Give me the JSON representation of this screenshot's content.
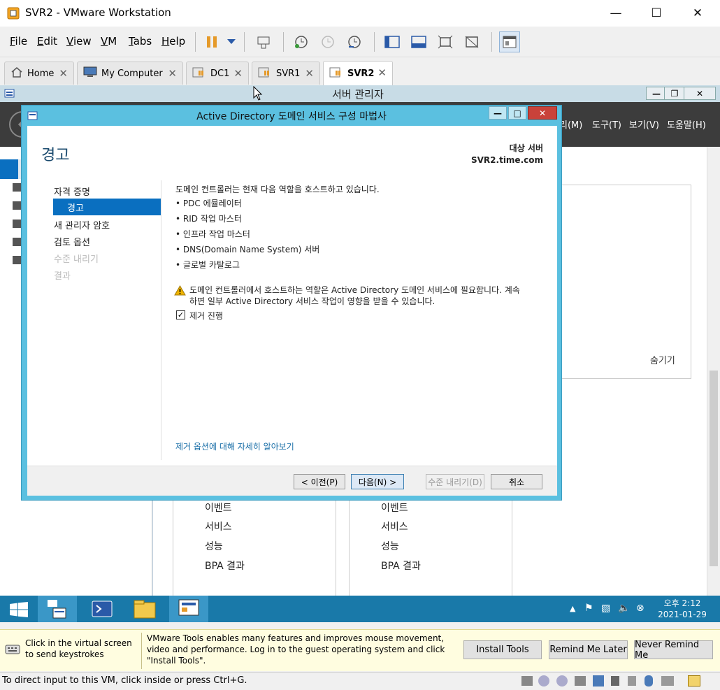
{
  "window": {
    "title": "SVR2 - VMware Workstation"
  },
  "menu": {
    "items": [
      {
        "label": "File",
        "key": "F",
        "rest": "ile"
      },
      {
        "label": "Edit",
        "key": "E",
        "rest": "dit"
      },
      {
        "label": "View",
        "key": "V",
        "rest": "iew"
      },
      {
        "label": "VM",
        "key": "V",
        "rest": "M"
      },
      {
        "label": "Tabs",
        "key": "T",
        "rest": "abs"
      },
      {
        "label": "Help",
        "key": "H",
        "rest": "elp"
      }
    ]
  },
  "tabs": [
    {
      "label": "Home",
      "icon": "home-icon"
    },
    {
      "label": "My Computer",
      "icon": "computer-icon"
    },
    {
      "label": "DC1",
      "icon": "vm-icon"
    },
    {
      "label": "SVR1",
      "icon": "vm-icon"
    },
    {
      "label": "SVR2",
      "icon": "vm-icon",
      "active": true
    }
  ],
  "server_manager": {
    "title": "서버 관리자",
    "menus": [
      "리(M)",
      "도구(T)",
      "보기(V)",
      "도움말(H)"
    ],
    "hide_label": "숨기기",
    "tiles": [
      {
        "items": [
          "이벤트",
          "서비스",
          "성능",
          "BPA 결과"
        ]
      },
      {
        "items": [
          "이벤트",
          "서비스",
          "성능",
          "BPA 결과"
        ]
      }
    ]
  },
  "wizard": {
    "title": "Active Directory 도메인 서비스 구성 마법사",
    "heading": "경고",
    "target_label": "대상 서버",
    "target_value": "SVR2.time.com",
    "nav": [
      {
        "label": "자격 증명",
        "state": "normal"
      },
      {
        "label": "경고",
        "state": "selected"
      },
      {
        "label": "새 관리자 암호",
        "state": "normal"
      },
      {
        "label": "검토 옵션",
        "state": "normal"
      },
      {
        "label": "수준 내리기",
        "state": "disabled"
      },
      {
        "label": "결과",
        "state": "disabled"
      }
    ],
    "intro": "도메인 컨트롤러는 현재 다음 역할을 호스트하고 있습니다.",
    "roles": [
      "PDC 에뮬레이터",
      "RID 작업 마스터",
      "인프라 작업 마스터",
      "DNS(Domain Name System) 서버",
      "글로벌 카탈로그"
    ],
    "warning_line1": "도메인 컨트롤러에서 호스트하는 역할은 Active Directory 도메인 서비스에 필요합니다. 계속",
    "warning_line2": "하면 일부 Active Directory 서비스 작업이 영향을 받을 수 있습니다.",
    "checkbox_label": "제거 진행",
    "checkbox_checked": true,
    "link": "제거 옵션에 대해 자세히 알아보기",
    "buttons": {
      "prev": "< 이전(P)",
      "next": "다음(N) >",
      "demote": "수준 내리기(D)",
      "cancel": "취소"
    }
  },
  "taskbar": {
    "clock_time": "오후 2:12",
    "clock_date": "2021-01-29"
  },
  "tools_bar": {
    "click_hint": "Click in the virtual screen to send keystrokes",
    "message": "VMware Tools enables many features and improves mouse movement, video and performance. Log in to the guest operating system and click \"Install Tools\".",
    "install": "Install Tools",
    "remind": "Remind Me Later",
    "never": "Never Remind Me"
  },
  "status": {
    "text": "To direct input to this VM, click inside or press Ctrl+G."
  },
  "colors": {
    "accent": "#0a6fc0",
    "wizard_frame": "#5bc0e0",
    "taskbar": "#1979a9",
    "link": "#1a6fa8",
    "warning": "#f0b400"
  }
}
